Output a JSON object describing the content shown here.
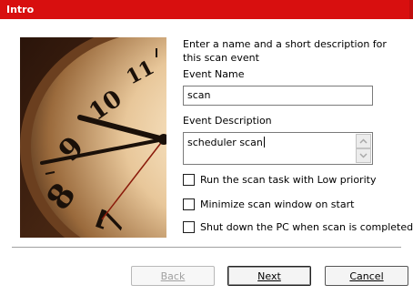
{
  "window": {
    "title": "Intro"
  },
  "image": {
    "description_icon": "clock-icon"
  },
  "form": {
    "instructions": "Enter a name and a short description for this scan event",
    "event_name_label": "Event Name",
    "event_name_value": "scan",
    "event_description_label": "Event Description",
    "event_description_value": "scheduler scan"
  },
  "options": [
    {
      "label": "Run the scan task with Low priority",
      "checked": false
    },
    {
      "label": "Minimize scan window on start",
      "checked": false
    },
    {
      "label": "Shut down the PC when scan is completed",
      "checked": false
    }
  ],
  "buttons": {
    "back": "Back",
    "next": "Next",
    "cancel": "Cancel"
  },
  "colors": {
    "titlebar": "#d80f0f"
  }
}
